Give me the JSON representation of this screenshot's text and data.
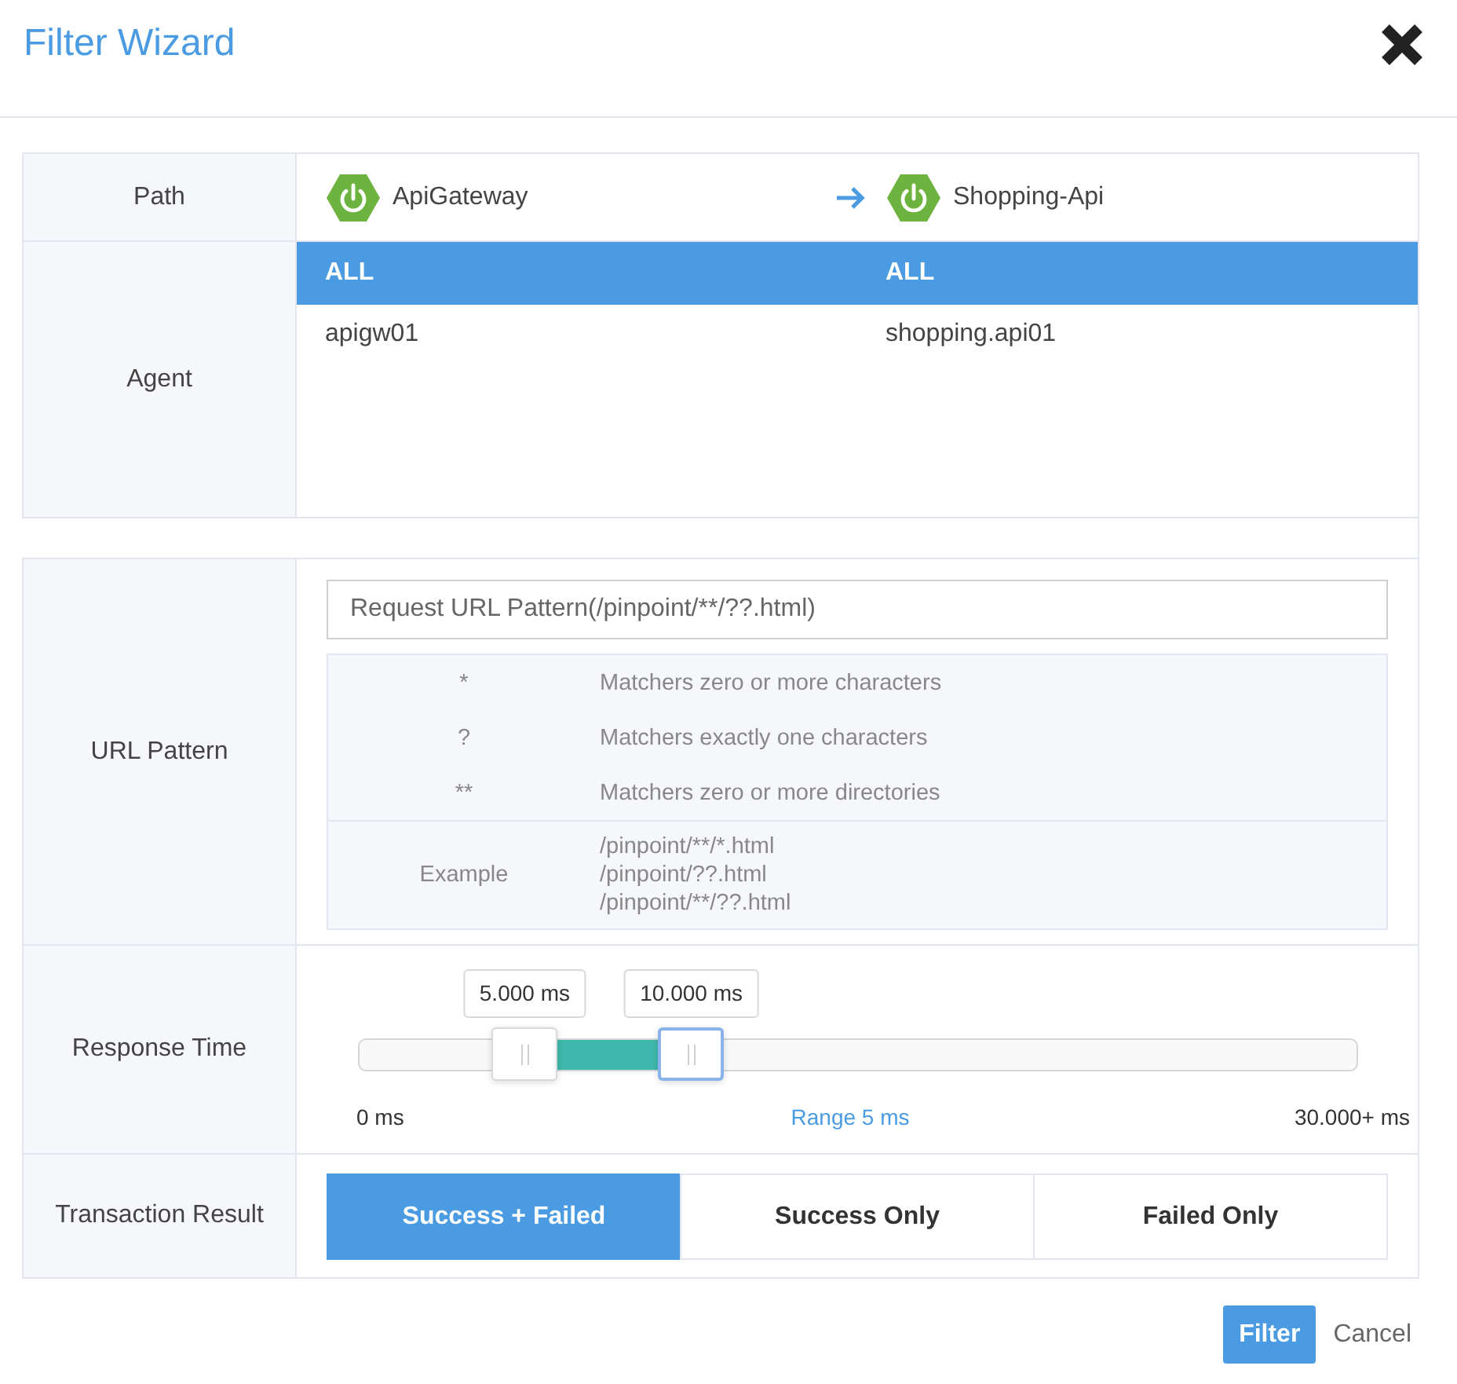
{
  "dialog": {
    "title": "Filter Wizard"
  },
  "path": {
    "label": "Path",
    "nodes": [
      {
        "name": "ApiGateway"
      },
      {
        "name": "Shopping-Api"
      }
    ]
  },
  "agent": {
    "label": "Agent",
    "lists": [
      {
        "items": [
          {
            "name": "ALL",
            "selected": true
          },
          {
            "name": "apigw01",
            "selected": false
          }
        ]
      },
      {
        "items": [
          {
            "name": "ALL",
            "selected": true
          },
          {
            "name": "shopping.api01",
            "selected": false
          }
        ]
      }
    ]
  },
  "url_pattern": {
    "label": "URL Pattern",
    "field": {
      "placeholder": "Request URL Pattern(/pinpoint/**/??.html)"
    },
    "rules": [
      {
        "symbol": "*",
        "description": "Matchers zero or more characters"
      },
      {
        "symbol": "?",
        "description": "Matchers exactly one characters"
      },
      {
        "symbol": "**",
        "description": "Matchers zero or more directories"
      }
    ],
    "example": {
      "label": "Example",
      "lines": [
        "/pinpoint/**/*.html",
        "/pinpoint/??.html",
        "/pinpoint/**/??.html"
      ]
    }
  },
  "response_time": {
    "label": "Response Time",
    "handles": [
      {
        "value": "5.000 ms",
        "level": 0.1667,
        "focused": false
      },
      {
        "value": "10.000 ms",
        "level": 0.3333,
        "focused": true
      }
    ],
    "min_label": "0 ms",
    "range_label": "Range 5 ms",
    "max_label": "30.000+ ms"
  },
  "transaction_result": {
    "label": "Transaction Result",
    "options": [
      {
        "label": "Success + Failed",
        "selected": true
      },
      {
        "label": "Success Only",
        "selected": false
      },
      {
        "label": "Failed Only",
        "selected": false
      }
    ]
  },
  "buttons": [
    {
      "label": "Filter",
      "kind": "primary"
    },
    {
      "label": "Cancel",
      "kind": "link"
    }
  ]
}
